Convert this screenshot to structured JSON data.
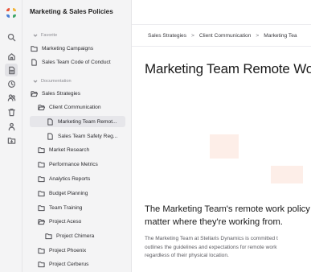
{
  "workspace": {
    "title": "Marketing & Sales Policies"
  },
  "sidebar": {
    "favorite_label": "Favorite",
    "favorites": [
      {
        "label": "Marketing Campaigns",
        "icon": "folder-icon"
      },
      {
        "label": "Sales Team Code of Conduct",
        "icon": "document-icon"
      }
    ],
    "documentation_label": "Documentation",
    "tree": [
      {
        "label": "Sales Strategies",
        "icon": "folder-open-icon",
        "level": 0
      },
      {
        "label": "Client Communication",
        "icon": "folder-open-icon",
        "level": 1
      },
      {
        "label": "Marketing Team Remot...",
        "icon": "document-icon",
        "level": 2,
        "selected": true
      },
      {
        "label": "Sales Team Safety Reg...",
        "icon": "document-icon",
        "level": 2
      },
      {
        "label": "Market Research",
        "icon": "folder-icon",
        "level": 1
      },
      {
        "label": "Performance Metrics",
        "icon": "folder-icon",
        "level": 1
      },
      {
        "label": "Analytics Reports",
        "icon": "folder-icon",
        "level": 1
      },
      {
        "label": "Budget Planning",
        "icon": "folder-icon",
        "level": 1
      },
      {
        "label": "Team Training",
        "icon": "folder-icon",
        "level": 1
      },
      {
        "label": "Project Aceso",
        "icon": "folder-open-icon",
        "level": 1
      },
      {
        "label": "Project Chimera",
        "icon": "folder-icon",
        "level": 2
      },
      {
        "label": "Project Phoenix",
        "icon": "folder-icon",
        "level": 1
      },
      {
        "label": "Project Cerberus",
        "icon": "folder-icon",
        "level": 1
      }
    ]
  },
  "rail": {
    "icons": [
      "search-icon",
      "home-icon",
      "document-icon",
      "recent-icon",
      "users-icon",
      "trash-icon",
      "person-icon",
      "archive-icon"
    ]
  },
  "main": {
    "breadcrumb": [
      "Sales Strategies",
      "Client Communication",
      "Marketing Tea"
    ],
    "breadcrumb_sep": ">",
    "title": "Marketing Team Remote Wo",
    "headline_line1": "The Marketing Team's remote work policy",
    "headline_line2": "matter where they're working from.",
    "body_line1": "The Marketing Team at Stellaris Dynamics is committed t",
    "body_line2": "outlines the guidelines and expectations for remote work",
    "body_line3": "regardless of their physical location."
  },
  "colors": {
    "logo": [
      "#e9553b",
      "#f2b53a",
      "#3fa66a",
      "#4b7fd6"
    ],
    "hero_accent": "#fdeee8"
  }
}
